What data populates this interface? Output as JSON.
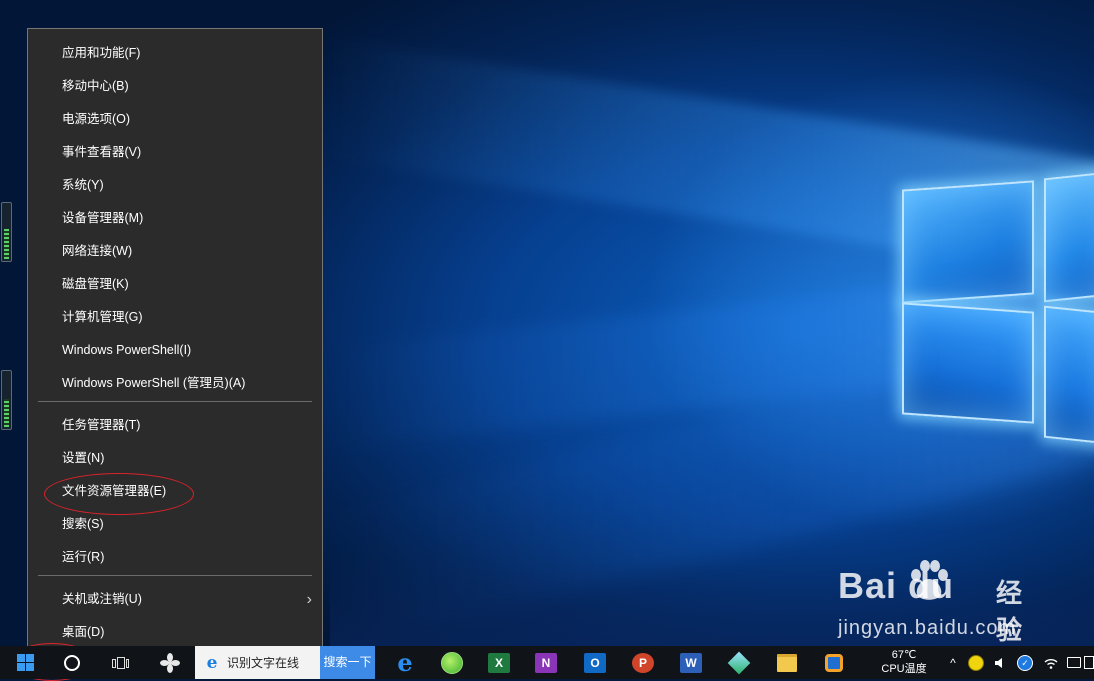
{
  "menu": {
    "groups": [
      [
        "应用和功能(F)",
        "移动中心(B)",
        "电源选项(O)",
        "事件查看器(V)",
        "系统(Y)",
        "设备管理器(M)",
        "网络连接(W)",
        "磁盘管理(K)",
        "计算机管理(G)",
        "Windows PowerShell(I)",
        "Windows PowerShell (管理员)(A)"
      ],
      [
        "任务管理器(T)",
        "设置(N)",
        "文件资源管理器(E)",
        "搜索(S)",
        "运行(R)"
      ],
      [
        "关机或注销(U)",
        "桌面(D)"
      ]
    ],
    "highlighted_item": "文件资源管理器(E)",
    "submenu_arrow_item": "关机或注销(U)"
  },
  "taskbar": {
    "search": {
      "value": "识别文字在线",
      "button": "搜索一下"
    },
    "pinned_apps": [
      "edge",
      "360-browser",
      "excel",
      "onenote",
      "outlook",
      "powerpoint",
      "word",
      "app-green",
      "file-explorer",
      "app-orange"
    ],
    "app_letters": {
      "excel": "X",
      "onenote": "N",
      "outlook": "O",
      "powerpoint": "P",
      "word": "W"
    },
    "tray": {
      "temperature": "67℃",
      "temperature_label": "CPU温度"
    }
  },
  "watermark": {
    "brand": "Bai du",
    "brand_cn": "经验",
    "url": "jingyan.baidu.com"
  },
  "colors": {
    "menu_bg": "#2b2b2b",
    "taskbar_bg": "#101419",
    "accent": "#3d8be6",
    "annotation": "#d9232b"
  }
}
